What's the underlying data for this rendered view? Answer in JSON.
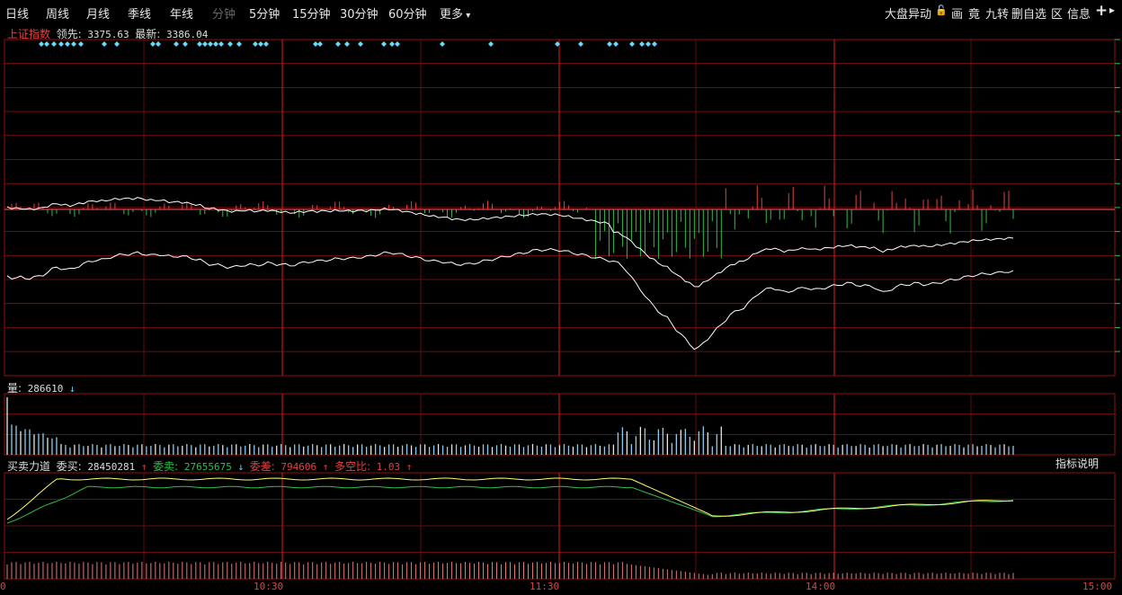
{
  "toolbar": {
    "tabs": [
      "日线",
      "周线",
      "月线",
      "季线",
      "年线",
      "分钟",
      "5分钟",
      "15分钟",
      "30分钟",
      "60分钟",
      "更多"
    ],
    "right_items": [
      "大盘异动",
      "画",
      "竟",
      "九转",
      "删自选",
      "区",
      "信息"
    ],
    "plus": "+",
    "more_caret": "▾"
  },
  "price_panel": {
    "name": "上证指数",
    "lead_label": "领先:",
    "lead_value": "3375.63",
    "latest_label": "最新:",
    "latest_value": "3386.04"
  },
  "volume_panel": {
    "label": "量:",
    "value": "286610",
    "arrow": "↓"
  },
  "force_panel": {
    "title": "买卖力道",
    "buy_label": "委买:",
    "buy_value": "28450281",
    "buy_arrow": "↑",
    "sell_label": "委卖:",
    "sell_value": "27655675",
    "sell_arrow": "↓",
    "diff_label": "委差:",
    "diff_value": "794606",
    "diff_arrow": "↑",
    "ratio_label": "多空比:",
    "ratio_value": "1.03",
    "ratio_arrow": "↑",
    "indicator_button": "指标说明"
  },
  "time_axis": [
    "0",
    "10:30",
    "11:30",
    "14:00",
    "15:00"
  ],
  "colors": {
    "up": "#e34141",
    "down": "#2fbf4a",
    "grid": "#8c1010",
    "line_main": "#ffffff",
    "line_avg": "#ffff66",
    "marker": "#66d9ff",
    "volume": "#8fcbee"
  },
  "chart_data": {
    "type": "line",
    "title": "上证指数",
    "x_ticks": [
      "0",
      "10:30",
      "11:30",
      "14:00",
      "15:00"
    ],
    "n_points": 225,
    "series": [
      {
        "name": "最新",
        "values_norm": [
          0.52,
          0.5,
          0.51,
          0.5,
          0.51,
          0.52,
          0.55,
          0.58,
          0.57,
          0.56,
          0.58,
          0.6,
          0.62,
          0.63,
          0.63,
          0.65,
          0.66,
          0.67,
          0.67,
          0.68,
          0.67,
          0.66,
          0.67,
          0.66,
          0.65,
          0.66,
          0.65,
          0.64,
          0.63,
          0.6,
          0.6,
          0.59,
          0.58,
          0.58,
          0.59,
          0.6,
          0.59,
          0.6,
          0.61,
          0.6,
          0.6,
          0.59,
          0.6,
          0.61,
          0.62,
          0.62,
          0.63,
          0.63,
          0.64,
          0.64,
          0.64,
          0.65,
          0.65,
          0.66,
          0.67,
          0.68,
          0.68,
          0.67,
          0.66,
          0.65,
          0.64,
          0.63,
          0.62,
          0.62,
          0.61,
          0.6,
          0.6,
          0.6,
          0.61,
          0.62,
          0.63,
          0.64,
          0.65,
          0.66,
          0.67,
          0.68,
          0.69,
          0.7,
          0.7,
          0.7,
          0.7,
          0.69,
          0.68,
          0.67,
          0.66,
          0.65,
          0.64,
          0.63,
          0.62,
          0.6,
          0.55,
          0.48,
          0.42,
          0.35,
          0.3,
          0.25,
          0.22,
          0.15,
          0.1,
          0.05,
          0.0,
          0.05,
          0.1,
          0.15,
          0.2,
          0.25,
          0.28,
          0.3,
          0.35,
          0.4,
          0.42,
          0.44,
          0.42,
          0.4,
          0.42,
          0.43,
          0.44,
          0.42,
          0.43,
          0.44,
          0.45,
          0.46,
          0.47,
          0.46,
          0.45,
          0.45,
          0.44,
          0.4,
          0.42,
          0.44,
          0.46,
          0.46,
          0.47,
          0.46,
          0.46,
          0.47,
          0.48,
          0.49,
          0.5,
          0.51,
          0.52,
          0.53,
          0.53,
          0.54,
          0.54,
          0.55,
          0.55
        ]
      },
      {
        "name": "领先",
        "values_norm": []
      }
    ]
  }
}
